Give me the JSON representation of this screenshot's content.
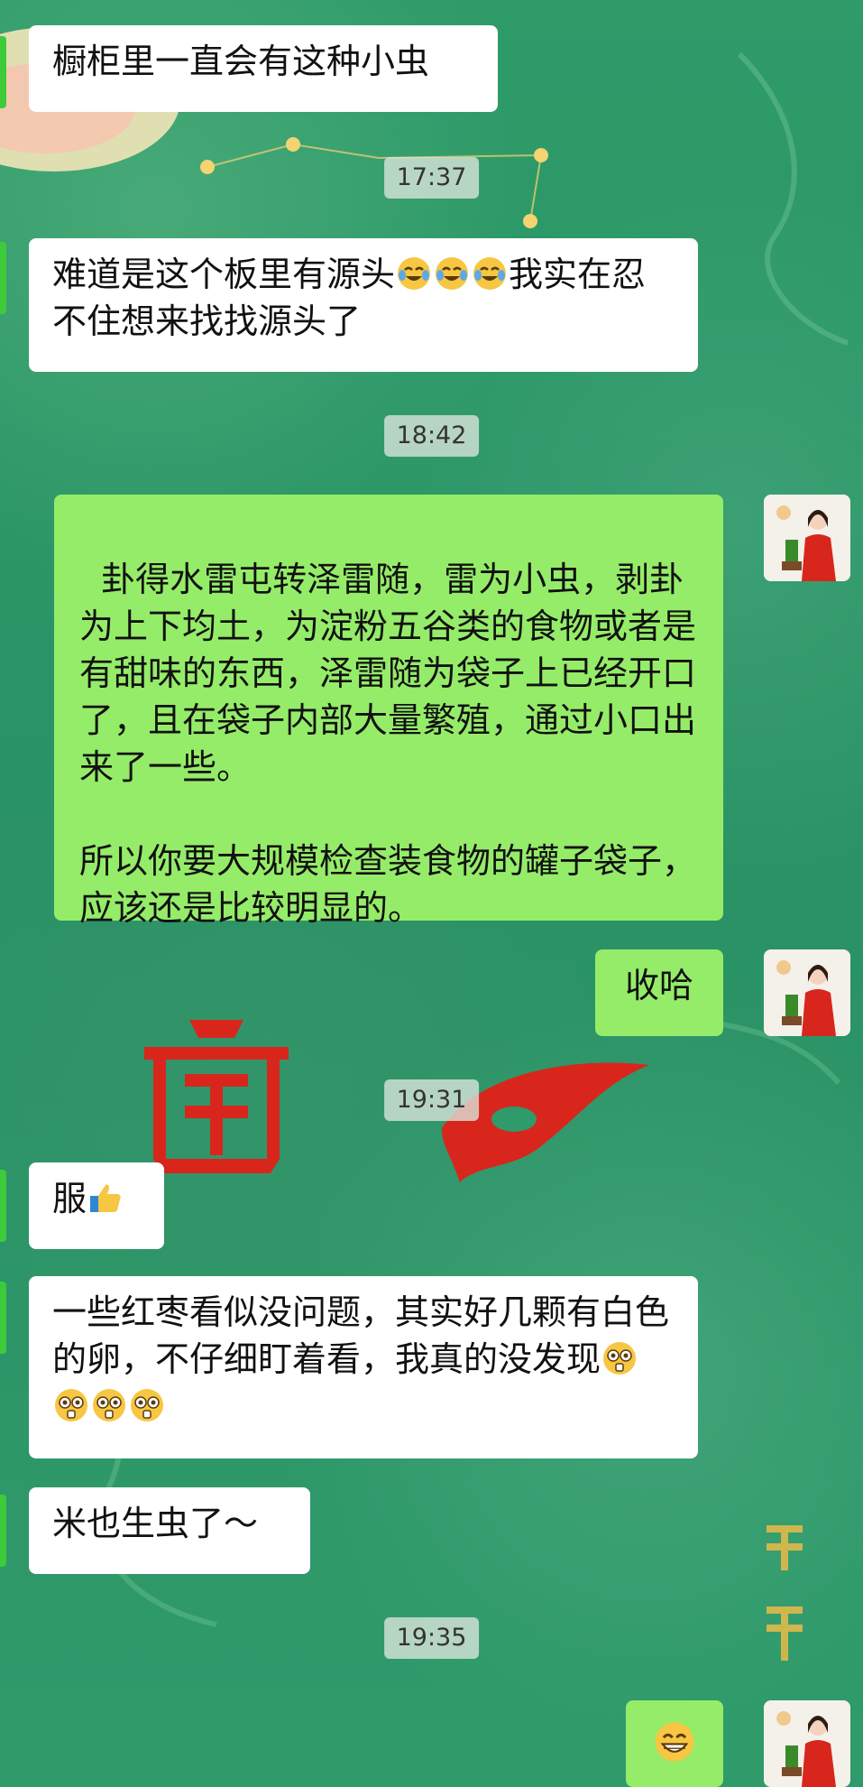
{
  "messages": [
    {
      "text": "橱柜里一直会有这种小虫"
    },
    {
      "text_a": "难道是这个板里有源头",
      "text_b": "我实在忍不住想来找找源头了",
      "emoji": "laughing-crying-emoji"
    },
    {
      "text": "卦得水雷屯转泽雷随，雷为小虫，剥卦为上下均土，为淀粉五谷类的食物或者是有甜味的东西，泽雷随为袋子上已经开口了，且在袋子内部大量繁殖，通过小口出来了一些。\n\n所以你要大规模检查装食物的罐子袋子，应该还是比较明显的。"
    },
    {
      "text": "收哈"
    },
    {
      "text": "服",
      "emoji": "thumbs-up-emoji"
    },
    {
      "text": "一些红枣看似没问题，其实好几颗有白色的卵，不仔细盯着看，我真的没发现",
      "emoji": "astonished-emoji"
    },
    {
      "text": "米也生虫了～"
    },
    {
      "emoji": "grinning-emoji"
    }
  ],
  "timestamps": [
    "17:37",
    "18:42",
    "19:31",
    "19:35"
  ],
  "colors": {
    "bubble_white": "#ffffff",
    "bubble_green": "#95ec69",
    "background": "#2f9a6a"
  }
}
